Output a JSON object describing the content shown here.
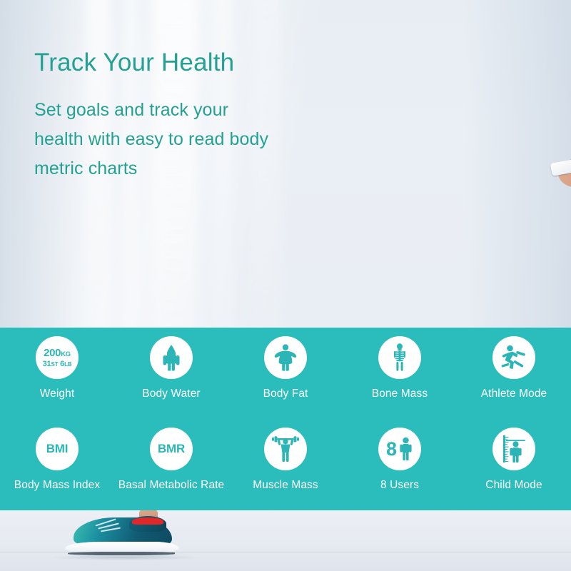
{
  "hero": {
    "headline": "Track Your Health",
    "subline": "Set goals and track your health with easy to read body metric charts",
    "photo_alt": "woman-stretching-with-phone"
  },
  "colors": {
    "band_teal": "#2bbdbb",
    "text_teal": "#24a193",
    "icon_teal": "#2bb5b6",
    "white": "#ffffff",
    "shoe_teal": "#12505f",
    "accent_red": "#e02828"
  },
  "features": {
    "row1": [
      {
        "label": "Weight",
        "icon": "weight-scale-icon",
        "value_kg": "200",
        "unit_kg": "KG",
        "value_st": "31",
        "unit_st": "ST",
        "value_lb": "6",
        "unit_lb": "LB"
      },
      {
        "label": "Body Water",
        "icon": "body-water-droplet-person-icon"
      },
      {
        "label": "Body Fat",
        "icon": "body-fat-person-icon"
      },
      {
        "label": "Bone Mass",
        "icon": "skeleton-icon"
      },
      {
        "label": "Athlete Mode",
        "icon": "running-person-icon"
      }
    ],
    "row2": [
      {
        "label": "Body Mass Index",
        "icon": "bmi-text-icon",
        "abbr": "BMI"
      },
      {
        "label": "Basal Metabolic Rate",
        "icon": "bmr-text-icon",
        "abbr": "BMR"
      },
      {
        "label": "Muscle Mass",
        "icon": "weightlifter-icon"
      },
      {
        "label": "8 Users",
        "icon": "eight-users-icon",
        "abbr": "8"
      },
      {
        "label": "Child Mode",
        "icon": "child-height-ruler-icon"
      }
    ]
  },
  "footer": {
    "image_alt": "teal-sneaker-on-floor"
  }
}
